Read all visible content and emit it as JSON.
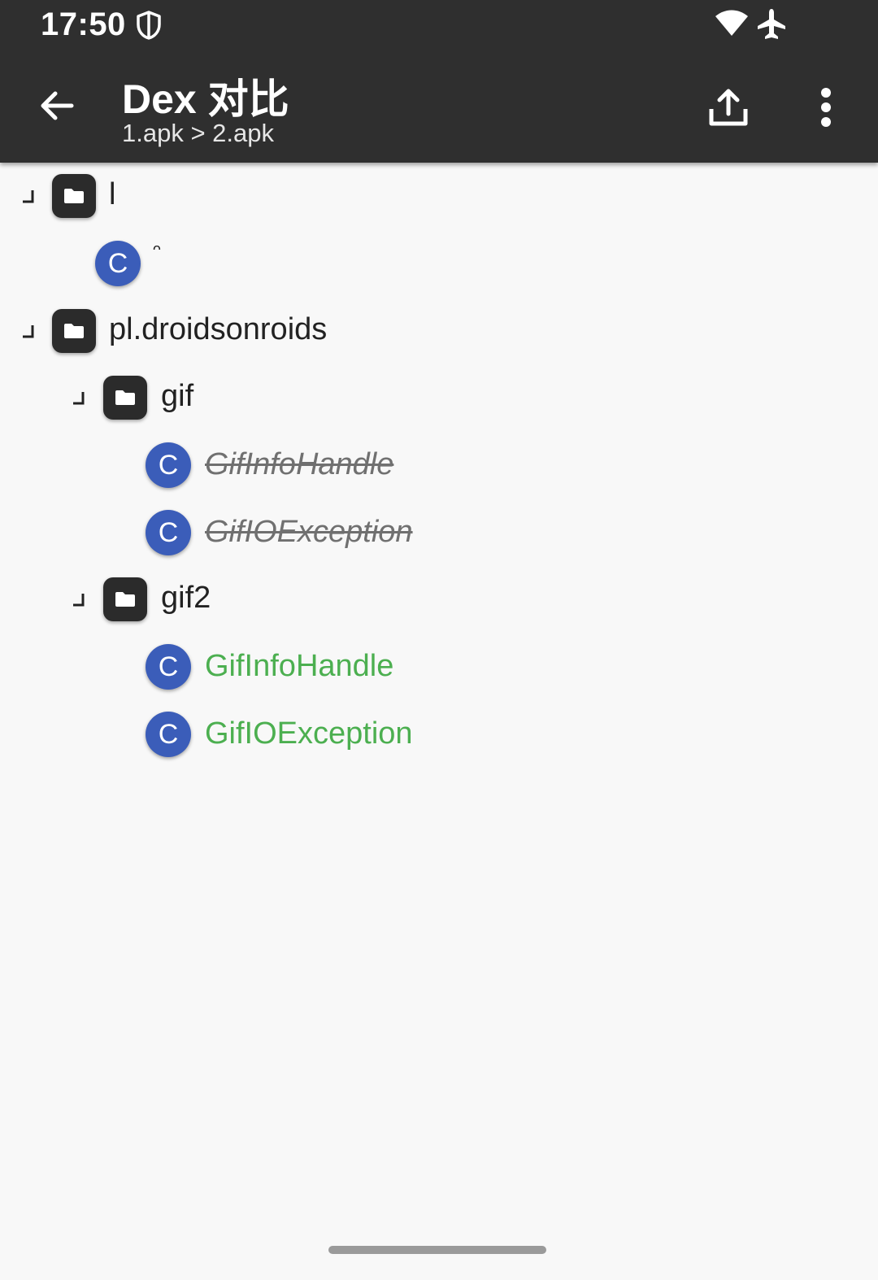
{
  "status_bar": {
    "time": "17:50",
    "icons": [
      "shield-icon",
      "wifi-icon",
      "airplane-icon"
    ]
  },
  "toolbar": {
    "back_icon": "arrow-left-icon",
    "title": "Dex 对比",
    "subtitle": "1.apk > 2.apk",
    "share_icon": "share-upload-icon",
    "more_icon": "more-vertical-icon"
  },
  "tree": {
    "colors": {
      "added": "#4caf50",
      "removed": "#707070",
      "class_icon": "#3b5db9",
      "folder_icon": "#2b2b2b"
    },
    "class_icon_letter": "C",
    "nodes": [
      {
        "type": "package",
        "label": "l",
        "depth": 0,
        "expanded": true
      },
      {
        "type": "class",
        "label": "ᵔ",
        "depth": 1,
        "state": "normal"
      },
      {
        "type": "package",
        "label": "pl.droidsonroids",
        "depth": 0,
        "expanded": true
      },
      {
        "type": "package",
        "label": "gif",
        "depth": 1,
        "expanded": true
      },
      {
        "type": "class",
        "label": "GifInfoHandle",
        "depth": 2,
        "state": "removed"
      },
      {
        "type": "class",
        "label": "GifIOException",
        "depth": 2,
        "state": "removed"
      },
      {
        "type": "package",
        "label": "gif2",
        "depth": 1,
        "expanded": true
      },
      {
        "type": "class",
        "label": "GifInfoHandle",
        "depth": 2,
        "state": "added"
      },
      {
        "type": "class",
        "label": "GifIOException",
        "depth": 2,
        "state": "added"
      }
    ]
  }
}
